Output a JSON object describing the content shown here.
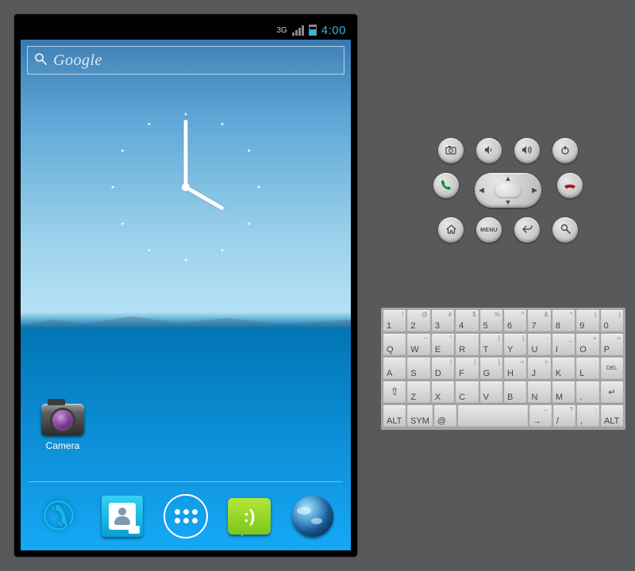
{
  "statusBar": {
    "network": "3G",
    "time": "4:00"
  },
  "search": {
    "placeholder": "Google"
  },
  "clock": {
    "hour": 4,
    "minute": 0
  },
  "homeIcons": {
    "camera": {
      "label": "Camera"
    }
  },
  "dock": [
    "phone",
    "contacts",
    "app-drawer",
    "messaging",
    "browser"
  ],
  "controls": {
    "row1": [
      "camera",
      "volume-down",
      "volume-up",
      "power"
    ],
    "row2": [
      "call",
      "dpad",
      "end-call"
    ],
    "row3": [
      "home",
      "menu",
      "back",
      "search"
    ],
    "menuLabel": "MENU"
  },
  "keyboard": {
    "row1": [
      {
        "k": "1",
        "a": "!"
      },
      {
        "k": "2",
        "a": "@"
      },
      {
        "k": "3",
        "a": "#"
      },
      {
        "k": "4",
        "a": "$"
      },
      {
        "k": "5",
        "a": "%"
      },
      {
        "k": "6",
        "a": "^"
      },
      {
        "k": "7",
        "a": "&"
      },
      {
        "k": "8",
        "a": "*"
      },
      {
        "k": "9",
        "a": "("
      },
      {
        "k": "0",
        "a": ")"
      }
    ],
    "row2": [
      {
        "k": "Q"
      },
      {
        "k": "W",
        "a": "~"
      },
      {
        "k": "E",
        "a": "\""
      },
      {
        "k": "R",
        "a": "'"
      },
      {
        "k": "T",
        "a": "{"
      },
      {
        "k": "Y",
        "a": "}"
      },
      {
        "k": "U",
        "a": "-"
      },
      {
        "k": "I",
        "a": "_"
      },
      {
        "k": "O",
        "a": "+"
      },
      {
        "k": "P",
        "a": "="
      }
    ],
    "row3": [
      {
        "k": "A"
      },
      {
        "k": "S",
        "a": "`"
      },
      {
        "k": "D",
        "a": "|"
      },
      {
        "k": "F",
        "a": "["
      },
      {
        "k": "G",
        "a": "]"
      },
      {
        "k": "H",
        "a": "<"
      },
      {
        "k": "J",
        "a": ">"
      },
      {
        "k": "K",
        ";": ";"
      },
      {
        "k": "L",
        "a": ":"
      },
      {
        "k": "DEL",
        "del": true
      }
    ],
    "row4": [
      {
        "k": "⇧",
        "shift": true
      },
      {
        "k": "Z"
      },
      {
        "k": "X"
      },
      {
        "k": "C"
      },
      {
        "k": "V"
      },
      {
        "k": "B"
      },
      {
        "k": "N"
      },
      {
        "k": "M"
      },
      {
        "k": "."
      },
      {
        "k": "↵",
        "enter": true
      }
    ],
    "row5": [
      {
        "k": "ALT"
      },
      {
        "k": "SYM"
      },
      {
        "k": "@"
      },
      {
        "k": " ",
        "space": true
      },
      {
        "k": "→",
        "a": "←"
      },
      {
        "k": "/",
        "a": "?"
      },
      {
        "k": ",",
        "a": ";"
      },
      {
        "k": "ALT"
      }
    ]
  }
}
